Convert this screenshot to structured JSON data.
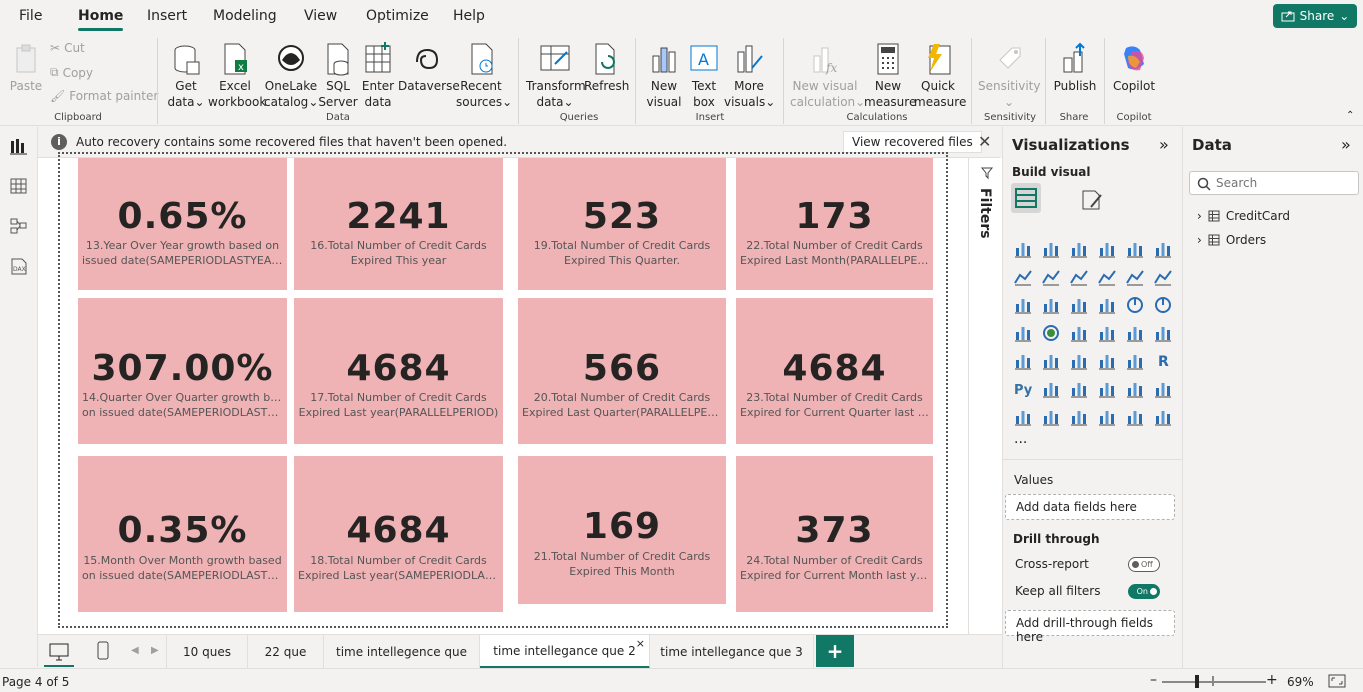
{
  "menu": {
    "items": [
      "File",
      "Home",
      "Insert",
      "Modeling",
      "View",
      "Optimize",
      "Help"
    ],
    "active": "Home",
    "share": "Share"
  },
  "ribbon": {
    "clipboard": {
      "paste": "Paste",
      "cut": "Cut",
      "copy": "Copy",
      "format_painter": "Format painter",
      "group": "Clipboard"
    },
    "data": {
      "get_data": [
        "Get",
        "data"
      ],
      "excel": [
        "Excel",
        "workbook"
      ],
      "onelake": [
        "OneLake",
        "catalog"
      ],
      "sql": [
        "SQL",
        "Server"
      ],
      "enter": [
        "Enter",
        "data"
      ],
      "dataverse": "Dataverse",
      "recent": [
        "Recent",
        "sources"
      ],
      "group": "Data"
    },
    "queries": {
      "transform": [
        "Transform",
        "data"
      ],
      "refresh": "Refresh",
      "group": "Queries"
    },
    "insert": {
      "new_visual": [
        "New",
        "visual"
      ],
      "text_box": [
        "Text",
        "box"
      ],
      "more_visuals": [
        "More",
        "visuals"
      ],
      "group": "Insert"
    },
    "calculations": {
      "new_visual_calc": [
        "New visual",
        "calculation"
      ],
      "new_measure": [
        "New",
        "measure"
      ],
      "quick_measure": [
        "Quick",
        "measure"
      ],
      "group": "Calculations"
    },
    "sensitivity": {
      "label": "Sensitivity",
      "group": "Sensitivity"
    },
    "share": {
      "publish": "Publish",
      "group": "Share"
    },
    "copilot": {
      "label": "Copilot",
      "group": "Copilot"
    }
  },
  "notice": {
    "text": "Auto recovery contains some recovered files that haven't been opened.",
    "button": "View recovered files"
  },
  "cards": [
    {
      "value": "0.65%",
      "label1": "13.Year Over Year growth based on",
      "label2": "issued date(SAMEPERIODLASTYEAR)"
    },
    {
      "value": "2241",
      "label1": "16.Total Number of Credit Cards",
      "label2": "Expired This year"
    },
    {
      "value": "523",
      "label1": "19.Total Number of Credit Cards",
      "label2": "Expired This Quarter."
    },
    {
      "value": "173",
      "label1": "22.Total Number of Credit Cards",
      "label2": "Expired Last Month(PARALLELPERIOD)"
    },
    {
      "value": "307.00%",
      "label1": "14.Quarter Over Quarter growth based",
      "label2": "on issued date(SAMEPERIODLASTYEAR)"
    },
    {
      "value": "4684",
      "label1": "17.Total Number of Credit Cards",
      "label2": "Expired Last year(PARALLELPERIOD)"
    },
    {
      "value": "566",
      "label1": "20.Total Number of Credit Cards",
      "label2": "Expired Last Quarter(PARALLELPERIOD)"
    },
    {
      "value": "4684",
      "label1": "23.Total Number of Credit Cards",
      "label2": "Expired for Current Quarter last year(..."
    },
    {
      "value": "0.35%",
      "label1": "15.Month Over Month growth based",
      "label2": "on issued date(SAMEPERIODLASTYEAR)"
    },
    {
      "value": "4684",
      "label1": "18.Total Number of Credit Cards",
      "label2": "Expired Last year(SAMEPERIODLASTYE..."
    },
    {
      "value": "169",
      "label1": "21.Total Number of Credit Cards",
      "label2": "Expired This Month"
    },
    {
      "value": "373",
      "label1": "24.Total Number of Credit Cards",
      "label2": "Expired for Current Month last year(S..."
    }
  ],
  "filters": {
    "label": "Filters"
  },
  "visualizations": {
    "title": "Visualizations",
    "build": "Build visual",
    "values": "Values",
    "add_fields": "Add data fields here",
    "drill": "Drill through",
    "cross_report": "Cross-report",
    "cross_state": "Off",
    "keep_filters": "Keep all filters",
    "keep_state": "On",
    "add_drill": "Add drill-through fields here",
    "py": "Py",
    "r": "R",
    "more": "..."
  },
  "data_pane": {
    "title": "Data",
    "search_placeholder": "Search",
    "tables": [
      "CreditCard",
      "Orders"
    ]
  },
  "tabs": [
    "10 ques",
    "22 que",
    "time intellegence que",
    "time intellegance que 2",
    "time intellegance que 3"
  ],
  "active_tab": "time intellegance que 2",
  "status": {
    "page": "Page 4 of 5",
    "zoom": "69%",
    "zoom_level": 0.69
  },
  "colors": {
    "accent": "#117865",
    "card": "#efb3b6"
  }
}
